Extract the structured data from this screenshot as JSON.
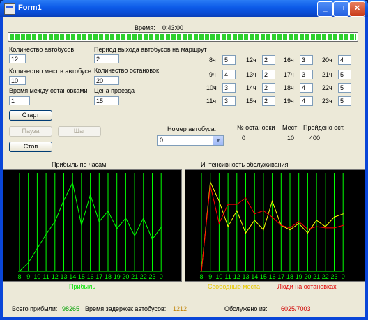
{
  "window": {
    "title": "Form1",
    "minimize": "_",
    "maximize": "□",
    "close": "✕"
  },
  "time": {
    "label": "Время:",
    "value": "0:43:00"
  },
  "progress": {
    "fraction": 1.0
  },
  "params": {
    "bus_count": {
      "label": "Количество автобусов",
      "value": "12"
    },
    "bus_seats": {
      "label": "Количество мест в автобусе",
      "value": "10"
    },
    "stop_interval": {
      "label": "Время между остановками",
      "value": "1"
    },
    "departure_period": {
      "label": "Период выхода автобусов на маршрут",
      "value": "2"
    },
    "stop_count": {
      "label": "Количество остановок",
      "value": "20"
    },
    "fare": {
      "label": "Цена проезда",
      "value": "15"
    }
  },
  "hourly": [
    {
      "h": "8ч",
      "v": "5"
    },
    {
      "h": "9ч",
      "v": "4"
    },
    {
      "h": "10ч",
      "v": "3"
    },
    {
      "h": "11ч",
      "v": "3"
    },
    {
      "h": "12ч",
      "v": "2"
    },
    {
      "h": "13ч",
      "v": "2"
    },
    {
      "h": "14ч",
      "v": "2"
    },
    {
      "h": "15ч",
      "v": "2"
    },
    {
      "h": "16ч",
      "v": "3"
    },
    {
      "h": "17ч",
      "v": "3"
    },
    {
      "h": "18ч",
      "v": "4"
    },
    {
      "h": "19ч",
      "v": "4"
    },
    {
      "h": "20ч",
      "v": "4"
    },
    {
      "h": "21ч",
      "v": "5"
    },
    {
      "h": "22ч",
      "v": "5"
    },
    {
      "h": "23ч",
      "v": "5"
    }
  ],
  "buttons": {
    "start": "Старт",
    "pause": "Пауза",
    "step": "Шаг",
    "stop": "Стоп"
  },
  "bus": {
    "number_label": "Номер автобуса:",
    "selected": "0",
    "stop_no_label": "№ остановки",
    "stop_no": "0",
    "seats_label": "Мест",
    "seats": "10",
    "passed_label": "Пройдено ост.",
    "passed": "400"
  },
  "colors": {
    "green": "#00ff00",
    "yellow": "#ffff00",
    "red": "#ff0000"
  },
  "chart_data": [
    {
      "type": "line",
      "title": "Прибыль по часам",
      "categories": [
        "8",
        "9",
        "10",
        "11",
        "12",
        "13",
        "14",
        "15",
        "16",
        "17",
        "18",
        "19",
        "20",
        "21",
        "22",
        "23",
        "0"
      ],
      "series": [
        {
          "name": "Прибыль",
          "color": "#00ff00",
          "values": [
            0,
            12,
            32,
            52,
            70,
            100,
            125,
            65,
            108,
            70,
            85,
            60,
            75,
            50,
            75,
            45,
            62
          ]
        }
      ],
      "ylim": [
        0,
        135
      ],
      "grid": true
    },
    {
      "type": "line",
      "title": "Интенсивность обслуживания",
      "categories": [
        "8",
        "9",
        "10",
        "11",
        "12",
        "13",
        "14",
        "15",
        "16",
        "17",
        "18",
        "19",
        "20",
        "21",
        "22",
        "23",
        "0"
      ],
      "series": [
        {
          "name": "Свободные места",
          "color": "#ffff00",
          "values": [
            0,
            140,
            110,
            70,
            95,
            60,
            80,
            65,
            110,
            72,
            65,
            75,
            60,
            80,
            70,
            85,
            90
          ]
        },
        {
          "name": "Люди на остановках",
          "color": "#ff0000",
          "values": [
            0,
            135,
            75,
            105,
            105,
            115,
            90,
            95,
            85,
            72,
            68,
            78,
            66,
            70,
            68,
            68,
            72
          ]
        }
      ],
      "ylim": [
        0,
        150
      ],
      "grid": true
    }
  ],
  "footer": {
    "profit_label": "Всего прибыли:",
    "profit": "98265",
    "delay_label": "Время задержек автобусов:",
    "delay": "1212",
    "served_label": "Обслужено из:",
    "served": "6025/7003"
  }
}
